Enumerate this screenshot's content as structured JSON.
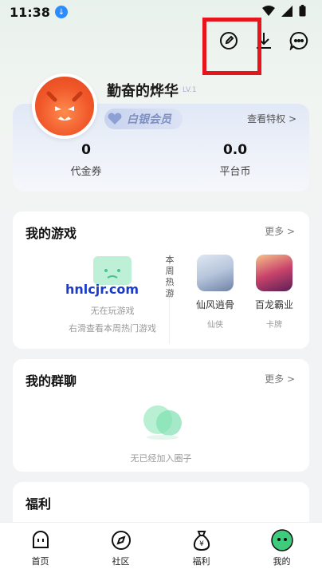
{
  "status": {
    "time": "11:38"
  },
  "profile": {
    "username": "勤奋的烨华",
    "level": "LV.1"
  },
  "vip": {
    "label": "白银会员",
    "privilege_link": "查看特权 >"
  },
  "stats": [
    {
      "value": "0",
      "label": "代金券"
    },
    {
      "value": "0.0",
      "label": "平台币"
    }
  ],
  "my_games": {
    "title": "我的游戏",
    "more": "更多 >",
    "empty_line1": "无在玩游戏",
    "empty_line2": "右滑查看本周热门游戏",
    "weekly_hot": "本周热游",
    "watermark": "hnlcjr.com",
    "games": [
      {
        "name": "仙风逍骨",
        "category": "仙侠"
      },
      {
        "name": "百龙霸业",
        "category": "卡牌"
      }
    ]
  },
  "my_groups": {
    "title": "我的群聊",
    "more": "更多 >",
    "empty": "无已经加入圈子"
  },
  "welfare": {
    "title": "福利"
  },
  "nav": [
    {
      "label": "首页",
      "icon": "home-icon"
    },
    {
      "label": "社区",
      "icon": "compass-icon"
    },
    {
      "label": "福利",
      "icon": "money-bag-icon"
    },
    {
      "label": "我的",
      "icon": "profile-face-icon"
    }
  ],
  "colors": {
    "accent_green": "#3ecb7c",
    "highlight_red": "#e8141b",
    "vip_text": "#7f90c4"
  }
}
